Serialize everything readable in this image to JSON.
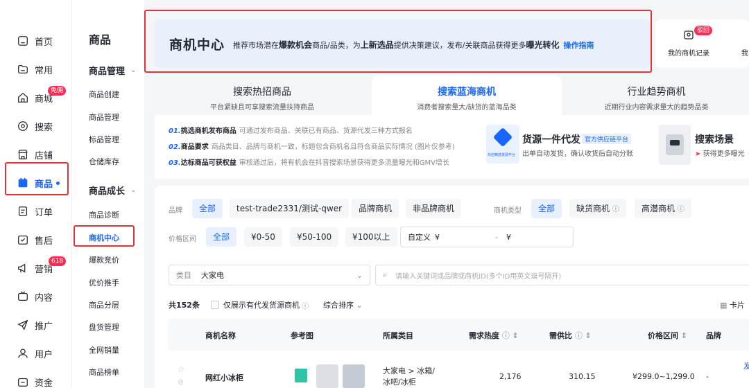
{
  "nav": {
    "items": [
      {
        "label": "首页",
        "icon": "home-icon"
      },
      {
        "label": "常用",
        "icon": "folder-icon"
      },
      {
        "label": "商城",
        "icon": "shop-icon",
        "badge": "免佣"
      },
      {
        "label": "搜索",
        "icon": "search-icon"
      },
      {
        "label": "店铺",
        "icon": "store-icon"
      },
      {
        "label": "商品",
        "icon": "product-icon"
      },
      {
        "label": "订单",
        "icon": "order-icon"
      },
      {
        "label": "售后",
        "icon": "after-sale-icon"
      },
      {
        "label": "营销",
        "icon": "megaphone-icon",
        "badge": "618"
      },
      {
        "label": "内容",
        "icon": "tv-icon"
      },
      {
        "label": "推广",
        "icon": "send-icon"
      },
      {
        "label": "用户",
        "icon": "user-icon"
      },
      {
        "label": "资金",
        "icon": "wallet-icon"
      }
    ]
  },
  "subnav": {
    "title": "商品",
    "group1": {
      "label": "商品管理",
      "items": [
        "商品创建",
        "商品管理",
        "标品管理",
        "仓储库存"
      ]
    },
    "group2": {
      "label": "商品成长",
      "items": [
        "商品诊断",
        "商机中心",
        "爆款竞价",
        "优价推手",
        "商品分层",
        "盘货管理",
        "全网销量",
        "商品榜单"
      ]
    }
  },
  "banner": {
    "title": "商机中心",
    "desc_pre": "推荐市场潜在",
    "desc_b1": "爆款机会",
    "desc_mid1": "商品/品类，为",
    "desc_b2": "上新选品",
    "desc_mid2": "提供决策建议，发布/关联商品获得更多",
    "desc_b3": "曝光转化",
    "guide": "操作指南"
  },
  "records": {
    "badge": "驳回",
    "label": "我的商机记录",
    "label2": "我"
  },
  "tabs": [
    {
      "title": "搜索热招商品",
      "sub": "平台紧缺且可享搜索流量扶持商品"
    },
    {
      "title": "搜索蓝海商机",
      "sub": "消费者搜索量大/缺货的蓝海品类"
    },
    {
      "title": "行业趋势商机",
      "sub": "近期行业内容需求量大的趋势品类"
    }
  ],
  "steps": [
    {
      "num": "01.",
      "head": "挑选商机发布商品",
      "text": "可通过发布商品、关联已有商品、货源代发三种方式报名"
    },
    {
      "num": "02.",
      "head": "商品要求",
      "text": "商品类目、品牌与商机一致，标题包含商机名且符合商品实际情况 (图片仅参考)"
    },
    {
      "num": "03.",
      "head": "达标商品可获权益",
      "text": "审核通过后，将有机会在抖音搜索场景获得更多流量曝光和GMV增长"
    }
  ],
  "promo1": {
    "title": "货源一件代发",
    "tag": "官方供应链平台",
    "sub": "出单自动发货，确认收货后自动分账",
    "logo": "抖店精选货源平台"
  },
  "promo2": {
    "title": "搜索场景",
    "sub": "获得更多曝光"
  },
  "filters": {
    "brand_label": "品牌",
    "brand_opts": [
      "全部",
      "test-trade2331/测试-qwer",
      "品牌商机",
      "非品牌商机"
    ],
    "type_label": "商机类型",
    "type_opts": [
      "全部",
      "缺货商机",
      "高潜商机"
    ],
    "price_label": "价格区间",
    "price_opts": [
      "全部",
      "¥0-50",
      "¥50-100",
      "¥100以上"
    ],
    "custom_label": "自定义",
    "custom_sym1": "¥",
    "custom_dash": "-",
    "custom_sym2": "¥",
    "category_label": "类目",
    "category_value": "大家电",
    "search_placeholder": "请输入关键词或品牌或商机ID(多个ID用英文逗号隔开)",
    "total": "共152条",
    "only_dropship": "仅展示有代发货源商机",
    "sort": "综合排序",
    "card_label": "卡片"
  },
  "table": {
    "headers": [
      "商机名称",
      "参考图",
      "所属类目",
      "需求热度",
      "需供比",
      "价格区间",
      "品牌"
    ],
    "rows": [
      {
        "name": "网红小冰柜",
        "category": "大家电 > 冰箱/冰吧/冰柜",
        "heat": "2,176",
        "ratio": "310.15",
        "price": "¥299.0~1,299.0",
        "brand": "-",
        "action": "发"
      }
    ]
  }
}
